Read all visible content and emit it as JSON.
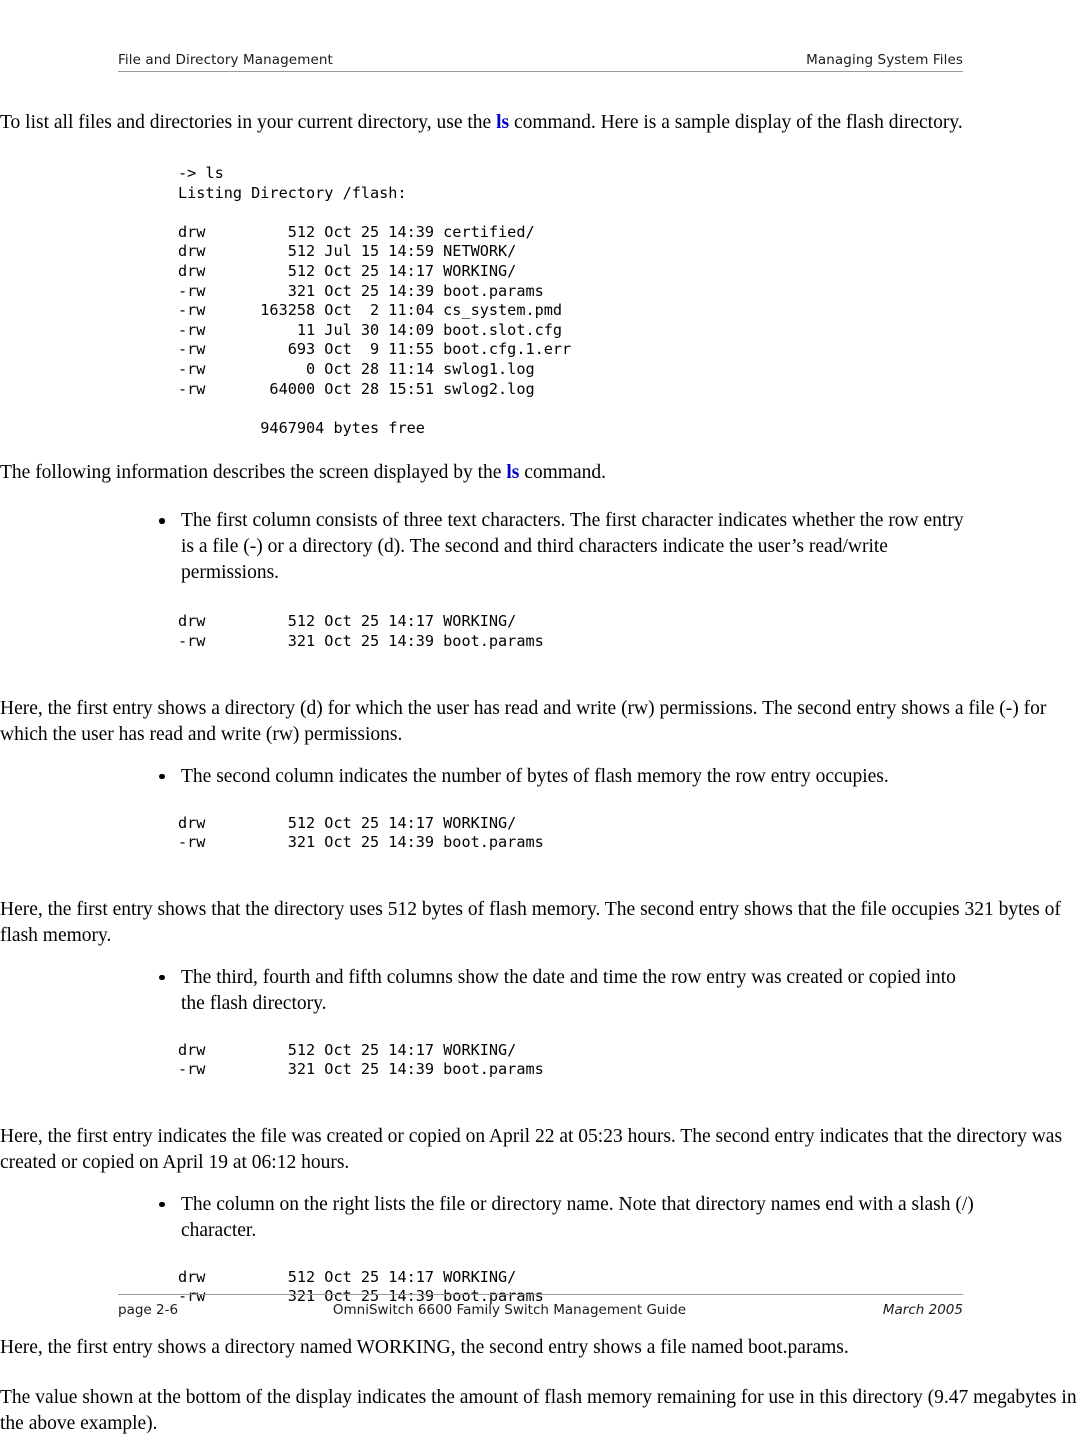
{
  "header": {
    "left": "File and Directory Management",
    "right": "Managing System Files"
  },
  "footer": {
    "page": "page 2-6",
    "guide": "OmniSwitch 6600 Family Switch Management Guide",
    "date": "March 2005"
  },
  "colors": {
    "command_blue": "#0000CC",
    "rule_gray": "#9A9A9A",
    "text": "#000000"
  },
  "intro": {
    "before_cmd": "To list all files and directories in your current directory, use the ",
    "cmd": "ls",
    "after_cmd": " command. Here is a sample display of the flash directory."
  },
  "listing": {
    "prompt_line": "-> ls",
    "title_line": "Listing Directory /flash:",
    "columns": [
      "perms",
      "size",
      "month",
      "day",
      "time",
      "name"
    ],
    "rows": [
      {
        "perms": "drw",
        "size": "512",
        "month": "Oct",
        "day": "25",
        "time": "14:39",
        "name": "certified/"
      },
      {
        "perms": "drw",
        "size": "512",
        "month": "Jul",
        "day": "15",
        "time": "14:59",
        "name": "NETWORK/"
      },
      {
        "perms": "drw",
        "size": "512",
        "month": "Oct",
        "day": "25",
        "time": "14:17",
        "name": "WORKING/"
      },
      {
        "perms": "-rw",
        "size": "321",
        "month": "Oct",
        "day": "25",
        "time": "14:39",
        "name": "boot.params"
      },
      {
        "perms": "-rw",
        "size": "163258",
        "month": "Oct",
        "day": "2",
        "time": "11:04",
        "name": "cs_system.pmd"
      },
      {
        "perms": "-rw",
        "size": "11",
        "month": "Jul",
        "day": "30",
        "time": "14:09",
        "name": "boot.slot.cfg"
      },
      {
        "perms": "-rw",
        "size": "693",
        "month": "Oct",
        "day": "9",
        "time": "11:55",
        "name": "boot.cfg.1.err"
      },
      {
        "perms": "-rw",
        "size": "0",
        "month": "Oct",
        "day": "28",
        "time": "11:14",
        "name": "swlog1.log"
      },
      {
        "perms": "-rw",
        "size": "64000",
        "month": "Oct",
        "day": "28",
        "time": "15:51",
        "name": "swlog2.log"
      }
    ],
    "free_line": "9467904 bytes free",
    "full_text": "-> ls\nListing Directory /flash:\n\ndrw         512 Oct 25 14:39 certified/\ndrw         512 Jul 15 14:59 NETWORK/\ndrw         512 Oct 25 14:17 WORKING/\n-rw         321 Oct 25 14:39 boot.params\n-rw      163258 Oct  2 11:04 cs_system.pmd\n-rw          11 Jul 30 14:09 boot.slot.cfg\n-rw         693 Oct  9 11:55 boot.cfg.1.err\n-rw           0 Oct 28 11:14 swlog1.log\n-rw       64000 Oct 28 15:51 swlog2.log\n\n         9467904 bytes free"
  },
  "describes": {
    "before_cmd": "The following information describes the screen displayed by the ",
    "cmd": "ls",
    "after_cmd": " command."
  },
  "sample_pair": {
    "text": "drw         512 Oct 25 14:17 WORKING/\n-rw         321 Oct 25 14:39 boot.params",
    "dir_line": "drw         512 Oct 25 14:17 WORKING/",
    "file_line": "-rw         321 Oct 25 14:39 boot.params"
  },
  "bullets": [
    {
      "id": "first-column",
      "text": "The first column consists of three text characters. The first character indicates whether the row entry is a file (-) or a directory (d). The second and third characters indicate the user’s read/write permissions.",
      "explanation": "Here, the first entry shows a directory (d) for which the user has read and write (rw) permissions. The second entry shows a file (-) for which the user has read and write (rw) permissions."
    },
    {
      "id": "second-column",
      "text": "The second column indicates the number of bytes of flash memory the row entry occupies.",
      "explanation": "Here, the first entry shows that the directory uses 512 bytes of flash memory. The second entry shows that the file occupies 321 bytes of flash memory."
    },
    {
      "id": "date-time-columns",
      "text": "The third, fourth and fifth columns show the date and time the row entry was created or copied into the flash directory.",
      "explanation": "Here, the first entry indicates the file was created or copied on April 22 at 05:23 hours. The second entry indicates that the directory was created or copied on April 19 at 06:12 hours."
    },
    {
      "id": "name-column",
      "text": "The column on the right lists the file or directory name. Note that directory names end with a slash (/) character.",
      "explanation": "Here, the first entry shows a directory named WORKING, the second entry shows a file named boot.params."
    }
  ],
  "closing": "The value shown at the bottom of the display indicates the amount of flash memory remaining for use in this directory (9.47 megabytes in the above example)."
}
